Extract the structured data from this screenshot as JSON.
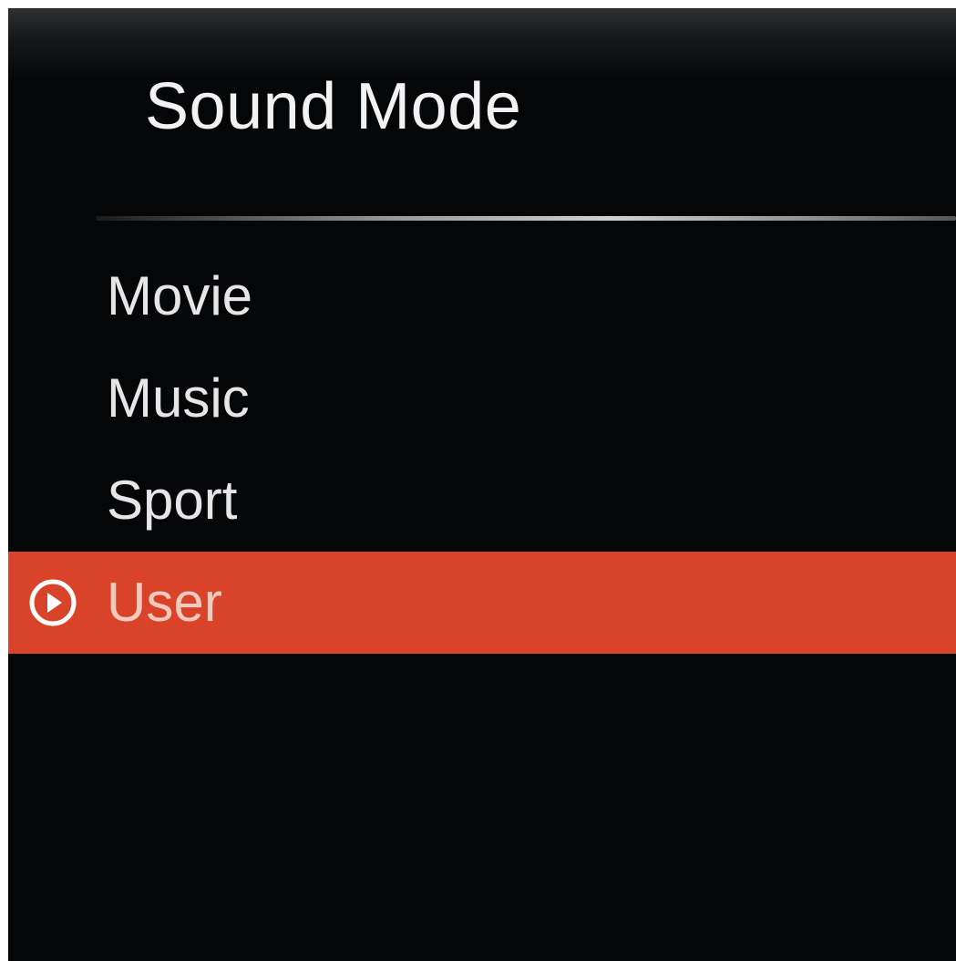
{
  "menu": {
    "title": "Sound Mode",
    "items": [
      {
        "label": "Movie",
        "selected": false
      },
      {
        "label": "Music",
        "selected": false
      },
      {
        "label": "Sport",
        "selected": false
      },
      {
        "label": "User",
        "selected": true,
        "icon": "play-circle-icon"
      }
    ]
  },
  "colors": {
    "background": "#050607",
    "highlight": "#d8432a",
    "text": "#e6e6e6"
  }
}
